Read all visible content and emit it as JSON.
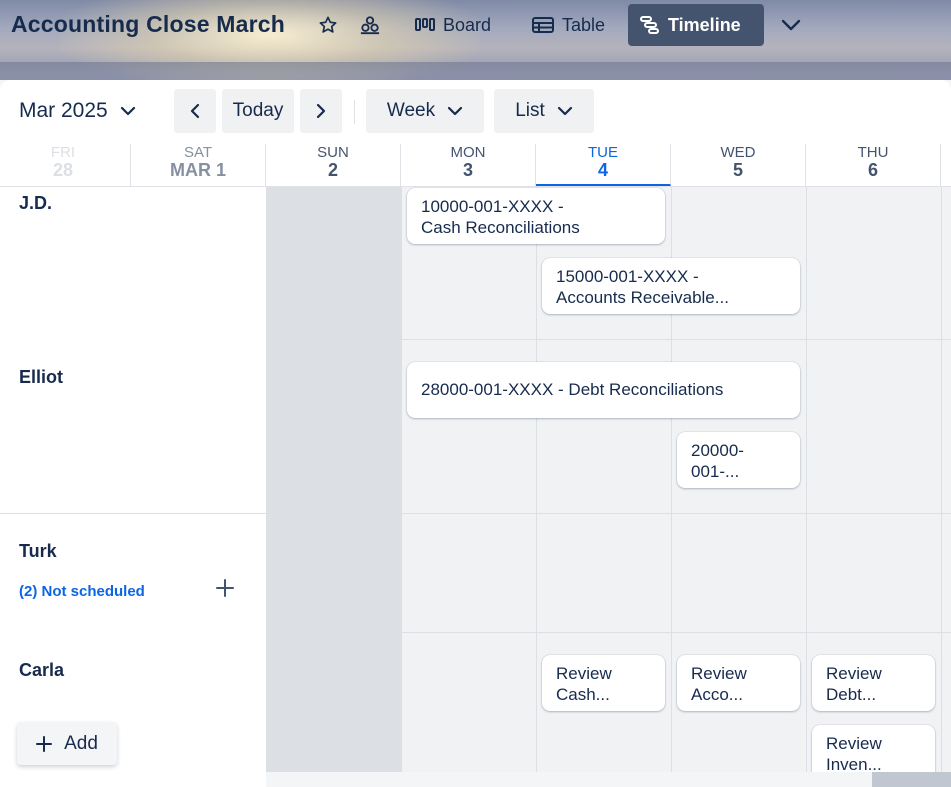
{
  "header": {
    "board_title": "Accounting Close March",
    "views": [
      {
        "label": "Board",
        "icon": "board-icon"
      },
      {
        "label": "Table",
        "icon": "table-icon"
      },
      {
        "label": "Timeline",
        "icon": "timeline-icon",
        "active": true
      }
    ],
    "icons": [
      "star-icon",
      "workspace-visibility-icon",
      "chevron-down-icon"
    ]
  },
  "toolbar": {
    "month": "Mar 2025",
    "today": "Today",
    "range": "Week",
    "grouping": "List"
  },
  "days": [
    {
      "dow": "FRI",
      "num": "28",
      "state": "faded"
    },
    {
      "dow": "SAT",
      "num": "MAR 1",
      "state": "muted"
    },
    {
      "dow": "SUN",
      "num": "2",
      "state": "normal"
    },
    {
      "dow": "MON",
      "num": "3",
      "state": "normal"
    },
    {
      "dow": "TUE",
      "num": "4",
      "state": "today"
    },
    {
      "dow": "WED",
      "num": "5",
      "state": "normal"
    },
    {
      "dow": "THU",
      "num": "6",
      "state": "normal"
    }
  ],
  "lanes": [
    {
      "name": "J.D.",
      "cards": [
        {
          "lines": [
            "10000-001-XXXX -",
            "Cash Reconciliations"
          ]
        },
        {
          "lines": [
            "15000-001-XXXX -",
            "Accounts Receivable..."
          ]
        }
      ]
    },
    {
      "name": "Elliot",
      "cards": [
        {
          "lines": [
            "28000-001-XXXX - Debt Reconciliations"
          ]
        },
        {
          "lines": [
            "20000-",
            "001-..."
          ]
        }
      ]
    },
    {
      "name": "Turk",
      "not_scheduled": "(2) Not scheduled",
      "cards": []
    },
    {
      "name": "Carla",
      "cards": [
        {
          "lines": [
            "Review",
            "Cash..."
          ]
        },
        {
          "lines": [
            "Review",
            "Acco..."
          ]
        },
        {
          "lines": [
            "Review",
            "Debt..."
          ]
        },
        {
          "lines": [
            "Review",
            "Inven..."
          ]
        }
      ]
    }
  ],
  "add_button": {
    "label": "Add"
  },
  "colors": {
    "accent": "#0c66e4",
    "active_tab": "#44546f",
    "weekend": "#dcdfe4"
  }
}
